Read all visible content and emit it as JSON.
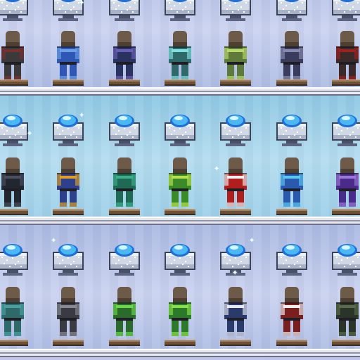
{
  "rows": [
    {
      "item": "crystal-display",
      "mannequins": [
        {
          "name": "mannequin-blank",
          "armor": "#3b3a3a",
          "accent": "#7a3030"
        },
        {
          "name": "mannequin-cobalt-armor",
          "armor": "#2f57b5",
          "accent": "#6da0e8"
        },
        {
          "name": "mannequin-shadow-armor",
          "armor": "#2a3360",
          "accent": "#6a5fb8"
        },
        {
          "name": "mannequin-frost-armor",
          "armor": "#2e6a6a",
          "accent": "#7fe0e0"
        },
        {
          "name": "mannequin-jungle-armor",
          "armor": "#5f7b3a",
          "accent": "#b8d86a"
        },
        {
          "name": "mannequin-necro-armor",
          "armor": "#3a3c5e",
          "accent": "#8a8ab0"
        },
        {
          "name": "mannequin-crimson-armor",
          "armor": "#3a2a2a",
          "accent": "#a02020"
        }
      ]
    },
    {
      "item": "crystal-display",
      "mannequins": [
        {
          "name": "mannequin-ninja-armor",
          "armor": "#22262e",
          "accent": "#4a5060"
        },
        {
          "name": "mannequin-wizard-armor",
          "armor": "#2e3f8e",
          "accent": "#e0a020"
        },
        {
          "name": "mannequin-teal-robe",
          "armor": "#1e6a55",
          "accent": "#3ab08a"
        },
        {
          "name": "mannequin-leaf-armor",
          "armor": "#3a8a2a",
          "accent": "#b9e34a"
        },
        {
          "name": "mannequin-royal-robe",
          "armor": "#b01e1e",
          "accent": "#f0f0f0"
        },
        {
          "name": "mannequin-ice-armor",
          "armor": "#2a5ab0",
          "accent": "#5ac8f0"
        },
        {
          "name": "mannequin-amethyst-robe",
          "armor": "#4a2a8a",
          "accent": "#9a7ad8"
        }
      ]
    },
    {
      "item": "crystal-display",
      "mannequins": [
        {
          "name": "mannequin-teal-tunic",
          "armor": "#2e6a6a",
          "accent": "#4aa0a0"
        },
        {
          "name": "mannequin-gray-armor",
          "armor": "#3a3a42",
          "accent": "#8a8a96"
        },
        {
          "name": "mannequin-chlorophyte-armor",
          "armor": "#2a6a2a",
          "accent": "#6ad84a"
        },
        {
          "name": "mannequin-turtle-armor",
          "armor": "#2a7a2a",
          "accent": "#8ae04a"
        },
        {
          "name": "mannequin-beetle-armor",
          "armor": "#2a3a6a",
          "accent": "#e8e8f0"
        },
        {
          "name": "mannequin-bone-armor",
          "armor": "#7a1e1e",
          "accent": "#f0f0f0"
        },
        {
          "name": "mannequin-dark-armor",
          "armor": "#2a3428",
          "accent": "#5a6a4a"
        }
      ]
    }
  ]
}
